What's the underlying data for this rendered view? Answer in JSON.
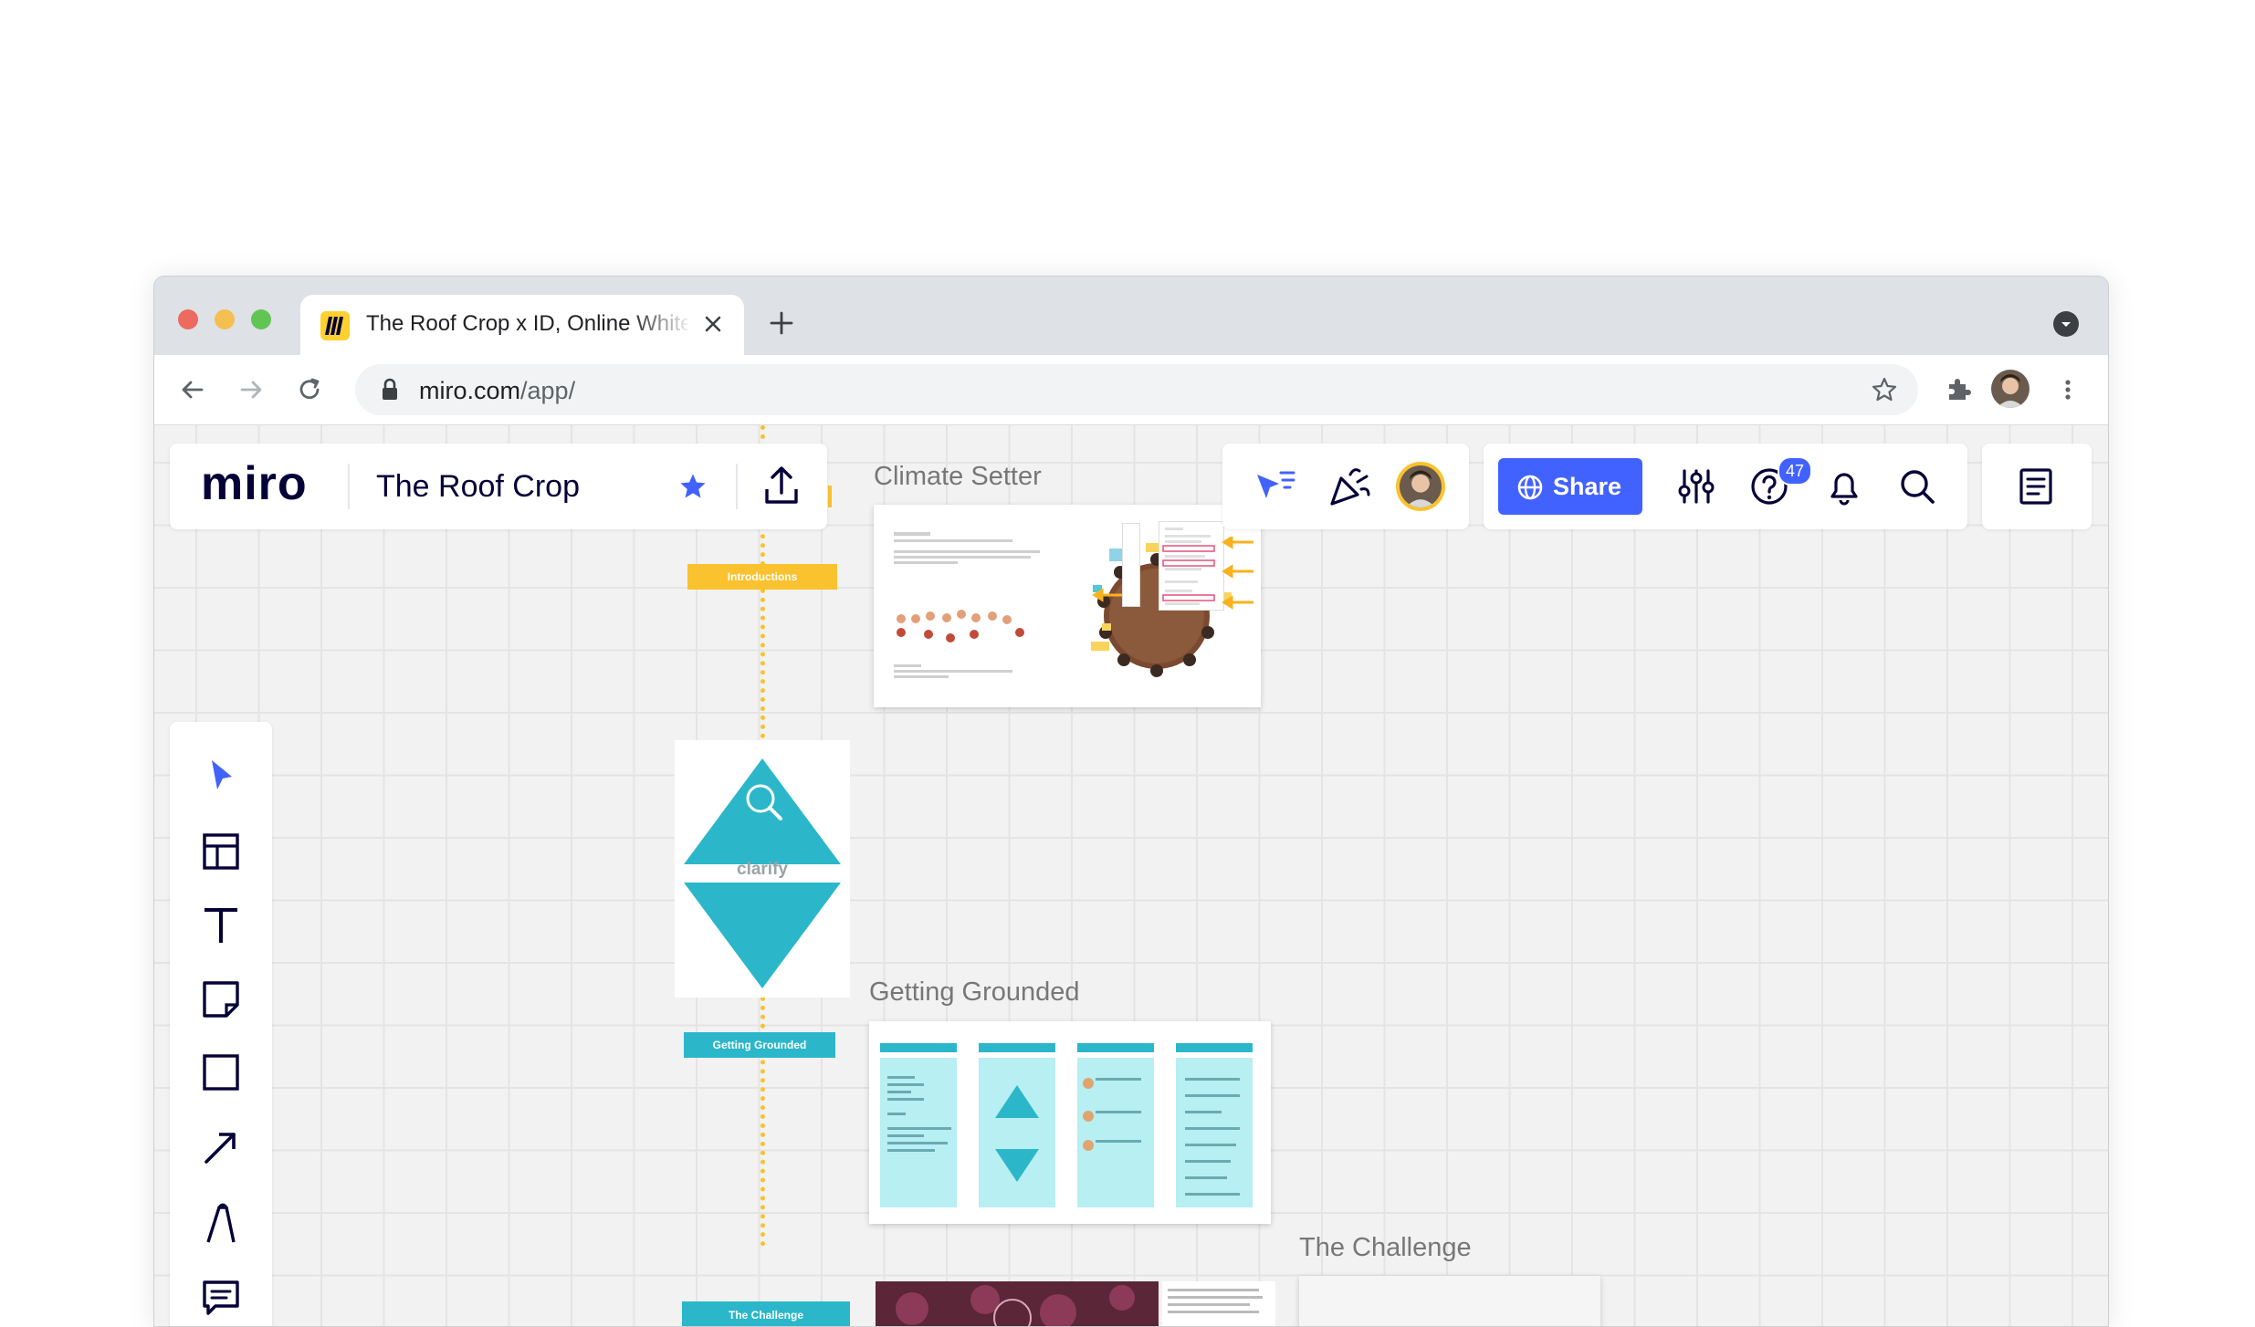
{
  "browser": {
    "tab_title": "The Roof Crop x ID, Online Whiteboard",
    "url_domain": "miro.com",
    "url_path": "/app/",
    "colors": {
      "close": "#ed6a5e",
      "minimize": "#f5bf4f",
      "maximize": "#61c554"
    }
  },
  "miro": {
    "logo": "miro",
    "board_name": "The Roof Crop",
    "share_label": "Share",
    "notification_count": "47",
    "accent": "#4262ff"
  },
  "board": {
    "frames": [
      {
        "title": "Climate Setter"
      },
      {
        "title": "Getting Grounded"
      },
      {
        "title": "The Challenge"
      }
    ],
    "labels": {
      "introductions": "Introductions",
      "clarify": "clarify",
      "getting_grounded": "Getting Grounded",
      "the_challenge": "The Challenge"
    },
    "colors": {
      "teal": "#2bb7c9",
      "yellow": "#f9c22e",
      "light_teal": "#b7eff2"
    }
  },
  "tools": [
    {
      "name": "select-icon"
    },
    {
      "name": "templates-icon"
    },
    {
      "name": "text-icon"
    },
    {
      "name": "sticky-note-icon"
    },
    {
      "name": "shape-icon"
    },
    {
      "name": "arrow-icon"
    },
    {
      "name": "pen-icon"
    },
    {
      "name": "comment-icon"
    }
  ]
}
